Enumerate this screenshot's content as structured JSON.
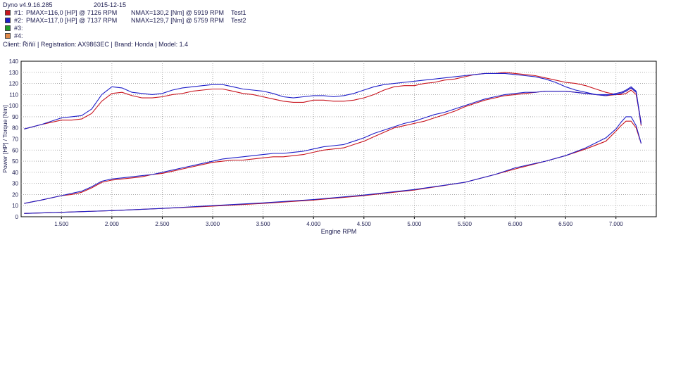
{
  "header": {
    "software": "Dyno v4.9.16.285",
    "date": "2015-12-15",
    "runs": [
      {
        "id": "#1:",
        "color": "#c8141e",
        "pmax": "PMAX=116,0 [HP] @ 7126 RPM",
        "nmax": "NMAX=130,2 [Nm] @ 5919 RPM",
        "name": "Test1"
      },
      {
        "id": "#2:",
        "color": "#1e1ec8",
        "pmax": "PMAX=117,0 [HP] @ 7137 RPM",
        "nmax": "NMAX=129,7 [Nm] @ 5759 RPM",
        "name": "Test2"
      },
      {
        "id": "#3:",
        "color": "#1e9a28",
        "pmax": "",
        "nmax": "",
        "name": ""
      },
      {
        "id": "#4:",
        "color": "#e08a4a",
        "pmax": "",
        "nmax": "",
        "name": ""
      }
    ],
    "client_line": "Client: Řiñíí | Registration: AX9863EC | Brand: Honda | Model: 1.4"
  },
  "chart_data": {
    "type": "line",
    "title": "",
    "xlabel": "Engine RPM",
    "ylabel": "Power [HP] / Torque [Nm]",
    "xlim": [
      1100,
      7400
    ],
    "ylim": [
      0,
      140
    ],
    "xticks": [
      1500,
      2000,
      2500,
      3000,
      3500,
      4000,
      4500,
      5000,
      5500,
      6000,
      6500,
      7000
    ],
    "xtick_labels": [
      "1.500",
      "2.000",
      "2.500",
      "3.000",
      "3.500",
      "4.000",
      "4.500",
      "5.000",
      "5.500",
      "6.000",
      "6.500",
      "7.000"
    ],
    "yticks": [
      0,
      10,
      20,
      30,
      40,
      50,
      60,
      70,
      80,
      90,
      100,
      110,
      120,
      130,
      140
    ],
    "grid": true,
    "series": [
      {
        "name": "Test1",
        "color": "#c8141e",
        "x": [
          1130,
          1300,
          1500,
          1600,
          1700,
          1800,
          1900,
          2000,
          2100,
          2200,
          2300,
          2400,
          2500,
          2600,
          2700,
          2800,
          2900,
          3000,
          3100,
          3200,
          3300,
          3400,
          3500,
          3600,
          3700,
          3800,
          3900,
          4000,
          4100,
          4200,
          4300,
          4400,
          4500,
          4600,
          4700,
          4800,
          4900,
          5000,
          5100,
          5200,
          5300,
          5400,
          5500,
          5600,
          5700,
          5800,
          5900,
          6000,
          6100,
          6200,
          6300,
          6400,
          6500,
          6600,
          6700,
          6800,
          6900,
          7000,
          7050,
          7100,
          7150,
          7200,
          7250
        ],
        "y": [
          79,
          83,
          87,
          87,
          88,
          93,
          104,
          111,
          112,
          109,
          107,
          107,
          108,
          110,
          111,
          113,
          114,
          115,
          115,
          113,
          111,
          110,
          108,
          106,
          104,
          103,
          103,
          105,
          105,
          104,
          104,
          105,
          107,
          110,
          114,
          117,
          118,
          118,
          120,
          121,
          123,
          124,
          126,
          128,
          129,
          129,
          130,
          129,
          128,
          127,
          125,
          123,
          121,
          120,
          118,
          115,
          112,
          110,
          110,
          111,
          114,
          110,
          85
        ]
      },
      {
        "name": "Test1",
        "color": "#c8141e",
        "x": [
          1130,
          1300,
          1500,
          1600,
          1700,
          1800,
          1900,
          2000,
          2100,
          2200,
          2300,
          2400,
          2500,
          2600,
          2700,
          2800,
          2900,
          3000,
          3100,
          3200,
          3300,
          3400,
          3500,
          3600,
          3700,
          3800,
          3900,
          4000,
          4100,
          4200,
          4300,
          4400,
          4500,
          4600,
          4700,
          4800,
          4900,
          5000,
          5100,
          5200,
          5300,
          5400,
          5500,
          5600,
          5700,
          5800,
          5900,
          6000,
          6100,
          6200,
          6300,
          6400,
          6500,
          6600,
          6700,
          6800,
          6900,
          7000,
          7050,
          7100,
          7150,
          7200,
          7250
        ],
        "y": [
          12,
          15,
          19,
          20,
          22,
          26,
          31,
          33,
          34,
          35,
          36,
          38,
          39,
          41,
          43,
          45,
          47,
          49,
          50,
          51,
          51,
          52,
          53,
          54,
          54,
          55,
          56,
          58,
          60,
          61,
          62,
          65,
          68,
          72,
          76,
          80,
          82,
          84,
          86,
          89,
          92,
          95,
          99,
          102,
          105,
          107,
          109,
          110,
          111,
          112,
          113,
          113,
          113,
          112,
          111,
          110,
          109,
          110,
          111,
          113,
          116,
          112,
          82
        ]
      },
      {
        "name": "Test1",
        "color": "#c8141e",
        "x": [
          1130,
          1500,
          2000,
          2500,
          3000,
          3500,
          4000,
          4500,
          5000,
          5500,
          5800,
          6000,
          6300,
          6500,
          6700,
          6900,
          7000,
          7050,
          7100,
          7150,
          7200,
          7250
        ],
        "y": [
          3,
          4,
          5.5,
          7.5,
          9.5,
          12,
          15,
          19,
          24,
          31,
          38,
          43,
          50,
          55,
          61,
          68,
          77,
          82,
          86,
          86,
          80,
          66
        ]
      },
      {
        "name": "Test2",
        "color": "#1e1ec8",
        "x": [
          1130,
          1300,
          1500,
          1600,
          1700,
          1800,
          1900,
          2000,
          2100,
          2200,
          2300,
          2400,
          2500,
          2600,
          2700,
          2800,
          2900,
          3000,
          3100,
          3200,
          3300,
          3400,
          3500,
          3600,
          3700,
          3800,
          3900,
          4000,
          4100,
          4200,
          4300,
          4400,
          4500,
          4600,
          4700,
          4800,
          4900,
          5000,
          5100,
          5200,
          5300,
          5400,
          5500,
          5600,
          5700,
          5800,
          5900,
          6000,
          6100,
          6200,
          6300,
          6400,
          6500,
          6600,
          6700,
          6800,
          6900,
          7000,
          7050,
          7100,
          7150,
          7200,
          7250
        ],
        "y": [
          79,
          83,
          89,
          90,
          91,
          97,
          110,
          117,
          116,
          112,
          111,
          110,
          111,
          114,
          116,
          117,
          118,
          119,
          119,
          117,
          115,
          114,
          113,
          111,
          108,
          107,
          108,
          109,
          109,
          108,
          109,
          111,
          114,
          117,
          119,
          120,
          121,
          122,
          123,
          124,
          125,
          126,
          127,
          128,
          129,
          129,
          129,
          128,
          127,
          126,
          124,
          121,
          117,
          114,
          112,
          110,
          110,
          110,
          111,
          113,
          116,
          112,
          84
        ]
      },
      {
        "name": "Test2",
        "color": "#1e1ec8",
        "x": [
          1130,
          1300,
          1500,
          1600,
          1700,
          1800,
          1900,
          2000,
          2100,
          2200,
          2300,
          2400,
          2500,
          2600,
          2700,
          2800,
          2900,
          3000,
          3100,
          3200,
          3300,
          3400,
          3500,
          3600,
          3700,
          3800,
          3900,
          4000,
          4100,
          4200,
          4300,
          4400,
          4500,
          4600,
          4700,
          4800,
          4900,
          5000,
          5100,
          5200,
          5300,
          5400,
          5500,
          5600,
          5700,
          5800,
          5900,
          6000,
          6100,
          6200,
          6300,
          6400,
          6500,
          6600,
          6700,
          6800,
          6900,
          7000,
          7050,
          7100,
          7150,
          7200,
          7250
        ],
        "y": [
          12,
          15,
          19,
          21,
          23,
          27,
          32,
          34,
          35,
          36,
          37,
          38,
          40,
          42,
          44,
          46,
          48,
          50,
          52,
          53,
          54,
          55,
          56,
          57,
          57,
          58,
          59,
          61,
          63,
          64,
          65,
          68,
          71,
          75,
          78,
          81,
          84,
          86,
          89,
          92,
          94,
          97,
          100,
          103,
          106,
          108,
          110,
          111,
          112,
          112,
          113,
          113,
          113,
          112,
          111,
          110,
          109,
          111,
          112,
          114,
          117,
          113,
          83
        ]
      },
      {
        "name": "Test2",
        "color": "#1e1ec8",
        "x": [
          1130,
          1500,
          2000,
          2500,
          3000,
          3500,
          4000,
          4500,
          5000,
          5500,
          5800,
          6000,
          6300,
          6500,
          6700,
          6900,
          7000,
          7050,
          7100,
          7150,
          7200,
          7250
        ],
        "y": [
          3,
          4,
          5.5,
          7.5,
          10,
          12.5,
          15.5,
          19.5,
          24.5,
          31,
          38,
          44,
          50,
          55,
          62,
          71,
          79,
          85,
          90,
          90,
          82,
          66
        ]
      }
    ]
  }
}
